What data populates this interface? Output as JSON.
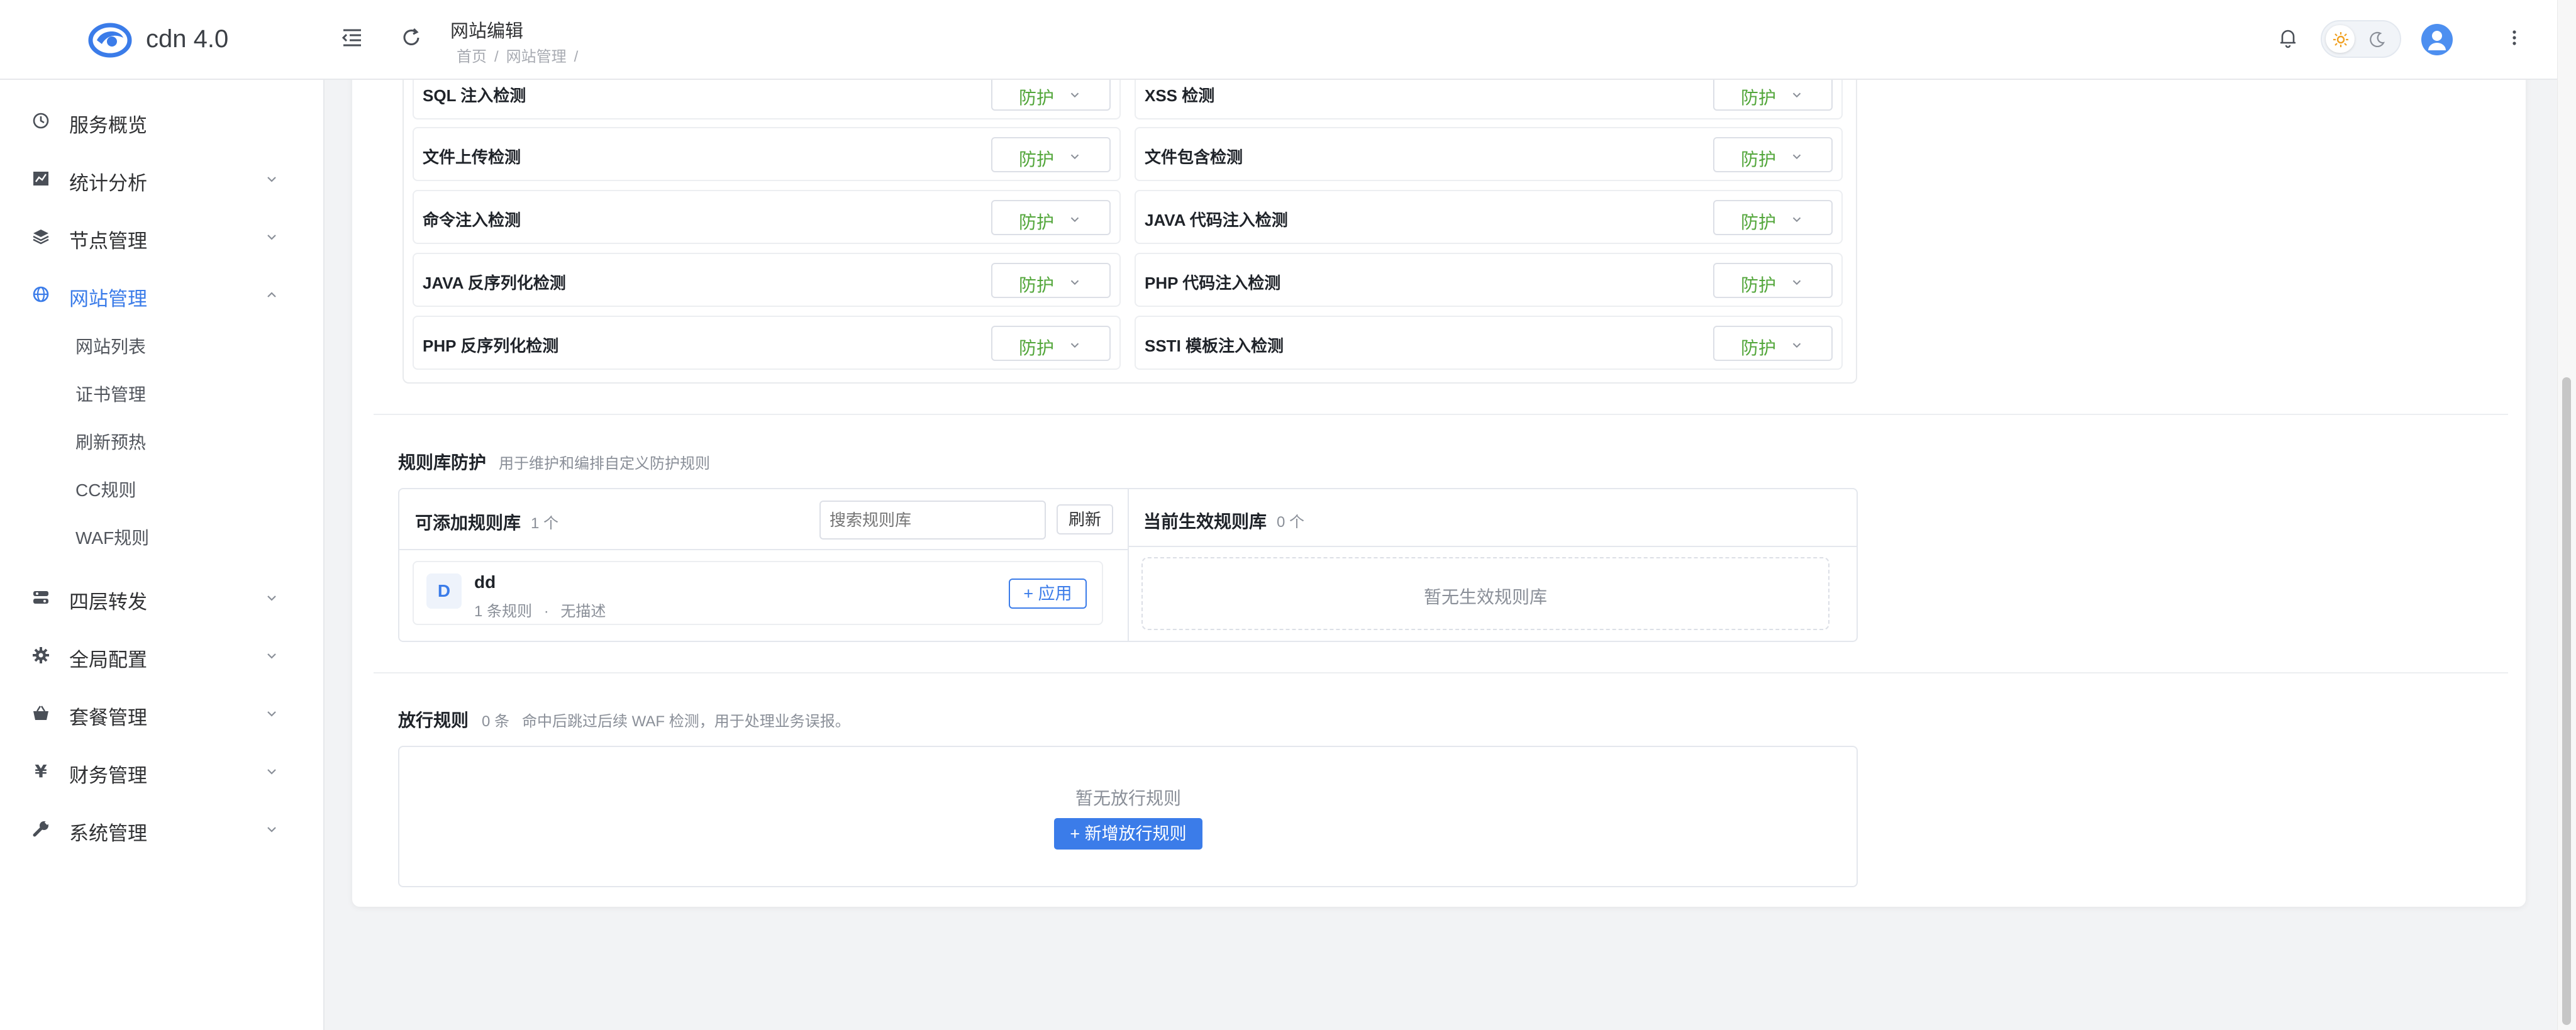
{
  "app": {
    "brand": "cdn 4.0"
  },
  "header": {
    "page_title": "网站编辑",
    "breadcrumbs": [
      "首页",
      "网站管理"
    ]
  },
  "sidebar": {
    "items": [
      {
        "label": "服务概览",
        "icon": "dashboard-icon"
      },
      {
        "label": "统计分析",
        "icon": "chart-icon"
      },
      {
        "label": "节点管理",
        "icon": "layers-icon"
      },
      {
        "label": "网站管理",
        "icon": "globe-icon",
        "expanded": true
      },
      {
        "label": "四层转发",
        "icon": "forward-icon"
      },
      {
        "label": "全局配置",
        "icon": "gear-icon"
      },
      {
        "label": "套餐管理",
        "icon": "basket-icon"
      },
      {
        "label": "财务管理",
        "icon": "yen-icon"
      },
      {
        "label": "系统管理",
        "icon": "wrench-icon"
      }
    ],
    "website_sub": [
      "网站列表",
      "证书管理",
      "刷新预热",
      "CC规则",
      "WAF规则"
    ]
  },
  "detections": [
    {
      "name": "SQL 注入检测",
      "value": "防护"
    },
    {
      "name": "XSS 检测",
      "value": "防护"
    },
    {
      "name": "文件上传检测",
      "value": "防护"
    },
    {
      "name": "文件包含检测",
      "value": "防护"
    },
    {
      "name": "命令注入检测",
      "value": "防护"
    },
    {
      "name": "JAVA 代码注入检测",
      "value": "防护"
    },
    {
      "name": "JAVA 反序列化检测",
      "value": "防护"
    },
    {
      "name": "PHP 代码注入检测",
      "value": "防护"
    },
    {
      "name": "PHP 反序列化检测",
      "value": "防护"
    },
    {
      "name": "SSTI 模板注入检测",
      "value": "防护"
    }
  ],
  "rule_lib": {
    "title": "规则库防护",
    "desc": "用于维护和编排自定义防护规则",
    "available_title": "可添加规则库",
    "available_count": "1 个",
    "search_placeholder": "搜索规则库",
    "refresh_label": "刷新",
    "libs": [
      {
        "badge": "D",
        "name": "dd",
        "rule_count": "1 条规则",
        "sep": "·",
        "desc": "无描述",
        "apply_label": "+ 应用"
      }
    ],
    "active_title": "当前生效规则库",
    "active_count": "0 个",
    "active_empty": "暂无生效规则库"
  },
  "allow_rules": {
    "title": "放行规则",
    "count": "0 条",
    "desc": "命中后跳过后续 WAF 检测，用于处理业务误报。",
    "empty": "暂无放行规则",
    "add_label": "+ 新增放行规则"
  },
  "colors": {
    "accent": "#3b7ce9",
    "protect_green": "#52a63a",
    "page_bg": "#f2f3f5"
  }
}
